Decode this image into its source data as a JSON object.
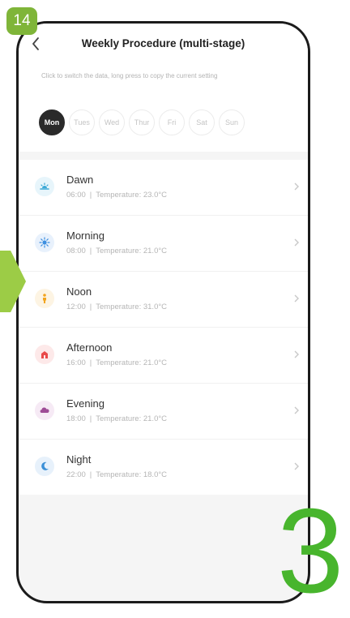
{
  "badge": {
    "step": "14"
  },
  "header": {
    "title": "Weekly Procedure (multi-stage)"
  },
  "hint": "Click to switch the data, long press to copy the current setting",
  "days": {
    "selected": "Mon",
    "items": [
      "Mon",
      "Tues",
      "Wed",
      "Thur",
      "Fri",
      "Sat",
      "Sun"
    ]
  },
  "stages": [
    {
      "name": "Dawn",
      "time": "06:00",
      "temperature_label": "Temperature: 23.0°C",
      "icon": "dawn-icon",
      "color": "#3aa8d6"
    },
    {
      "name": "Morning",
      "time": "08:00",
      "temperature_label": "Temperature: 21.0°C",
      "icon": "sun-icon",
      "color": "#3d8fe0"
    },
    {
      "name": "Noon",
      "time": "12:00",
      "temperature_label": "Temperature: 31.0°C",
      "icon": "person-icon",
      "color": "#f3a51f"
    },
    {
      "name": "Afternoon",
      "time": "16:00",
      "temperature_label": "Temperature: 21.0°C",
      "icon": "house-icon",
      "color": "#e94a4a"
    },
    {
      "name": "Evening",
      "time": "18:00",
      "temperature_label": "Temperature: 21.0°C",
      "icon": "cloud-icon",
      "color": "#9e4b96"
    },
    {
      "name": "Night",
      "time": "22:00",
      "temperature_label": "Temperature: 18.0°C",
      "icon": "moon-icon",
      "color": "#3b8fd6"
    }
  ],
  "annotation": {
    "step_number": "3"
  },
  "colors": {
    "accent_badge": "#7fb539",
    "annotation_green": "#48b52d",
    "arrow": "#9ccc46",
    "day_active": "#2a2a2a"
  }
}
